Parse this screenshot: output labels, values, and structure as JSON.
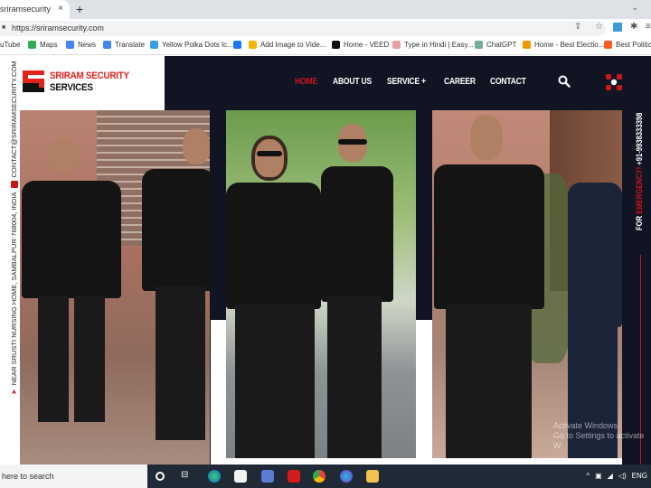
{
  "browser": {
    "tab_title": "sriramsecurity",
    "close_tab": "×",
    "new_tab": "+",
    "tab_strip_menu": "⌄",
    "url": "https://sriramsecurity.com",
    "bookmarks": [
      {
        "label": "uTube",
        "icon": "youtube-icon",
        "color": "#ff0000"
      },
      {
        "label": "Maps",
        "icon": "maps-icon",
        "color": "#34a853"
      },
      {
        "label": "News",
        "icon": "news-icon",
        "color": "#4285f4"
      },
      {
        "label": "Translate",
        "icon": "translate-icon",
        "color": "#4285f4"
      },
      {
        "label": "Yellow Polka Dots Ic...",
        "icon": "doc-icon",
        "color": "#3aa0e0"
      },
      {
        "label": "",
        "icon": "facebook-icon",
        "color": "#1877f2"
      },
      {
        "label": "Add Image to Vide...",
        "icon": "app-icon",
        "color": "#f4b400"
      },
      {
        "label": "Home - VEED",
        "icon": "veed-icon",
        "color": "#111111"
      },
      {
        "label": "Type in Hindi | Easy...",
        "icon": "hindi-icon",
        "color": "#e8a0a0"
      },
      {
        "label": "ChatGPT",
        "icon": "chatgpt-icon",
        "color": "#74aa9c"
      },
      {
        "label": "Home - Best Electio...",
        "icon": "election-icon",
        "color": "#f29900"
      },
      {
        "label": "Best Politica",
        "icon": "h-icon",
        "color": "#ff5a1f"
      }
    ]
  },
  "site": {
    "logo_line1": "SRIRAM SECURITY",
    "logo_line2": "SERVICES",
    "nav": [
      {
        "label": "HOME",
        "active": true
      },
      {
        "label": "ABOUT US",
        "active": false
      },
      {
        "label": "SERVICE +",
        "active": false
      },
      {
        "label": "CAREER",
        "active": false
      },
      {
        "label": "CONTACT",
        "active": false
      }
    ],
    "address": "NEAR SRUSTI NURSING HOME, SAMBALPUR-768004, INDIA",
    "contact_email": "CONTACT@SRIRAMSECURITY.COM",
    "emergency_prefix": "FOR ",
    "emergency_word": "EMERGENCY!",
    "emergency_phone": " +91-9938333398",
    "colors": {
      "accent": "#c8161d",
      "dark": "#111422"
    }
  },
  "os": {
    "watermark_line1": "Activate Windows",
    "watermark_line2": "Go to Settings to activate W",
    "search_placeholder": "here to search",
    "language": "ENG"
  }
}
